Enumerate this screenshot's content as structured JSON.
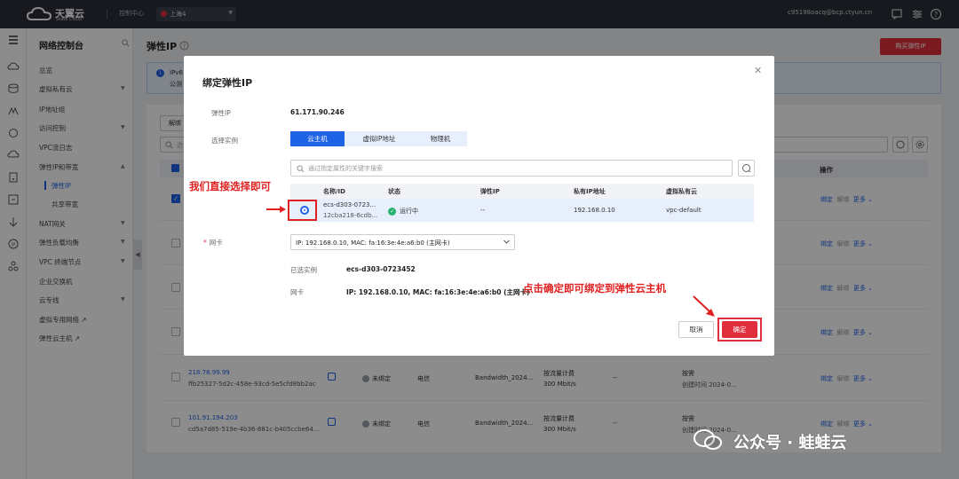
{
  "topbar": {
    "brand": "天翼云",
    "brand_sub": "State Cloud",
    "console": "控制中心",
    "region": "上海4",
    "user": "c95198oacq@bcp.ctyun.cn"
  },
  "sidebar": {
    "title": "网络控制台",
    "items": [
      {
        "label": "总览",
        "caret": false
      },
      {
        "label": "虚拟私有云",
        "caret": true
      },
      {
        "label": "IP地址组",
        "caret": false
      },
      {
        "label": "访问控制",
        "caret": true
      },
      {
        "label": "VPC流日志",
        "caret": false
      },
      {
        "label": "弹性IP和带宽",
        "caret": true
      },
      {
        "label": "弹性IP",
        "caret": false
      },
      {
        "label": "共享带宽",
        "caret": false
      },
      {
        "label": "NAT网关",
        "caret": true
      },
      {
        "label": "弹性负载均衡",
        "caret": true
      },
      {
        "label": "VPC 终端节点",
        "caret": true
      },
      {
        "label": "企业交换机",
        "caret": false
      },
      {
        "label": "云专线",
        "caret": true
      },
      {
        "label": "虚拟专用网络 ↗",
        "caret": false
      },
      {
        "label": "弹性云主机 ↗",
        "caret": false
      }
    ]
  },
  "main": {
    "title": "弹性IP",
    "buy_button": "购买弹性IP",
    "notice_line1": "IPv6",
    "notice_line2": "公测",
    "unbind_button": "解绑",
    "filter_placeholder": "选",
    "ops_header": "操作",
    "row_ops": {
      "bind": "绑定",
      "unbind": "解绑",
      "more": "更多"
    },
    "rows": [
      {
        "ip": "218.78.99.99",
        "id": "ffb25327-5d2c-458e-93cd-5e5cfd8bb2ac",
        "status": "未绑定",
        "isp": "电信",
        "bandwidth": "Bandwidth_2024...",
        "billing1": "按流量计费",
        "billing2": "300 Mbit/s",
        "dash": "--",
        "pay": "按需",
        "created": "创建时间 2024-0..."
      },
      {
        "ip": "101.91.194.203",
        "id": "cd5a7d85-519e-4b36-881c-b405ccbe64...",
        "status": "未绑定",
        "isp": "电信",
        "bandwidth": "Bandwidth_2024...",
        "billing1": "按流量计费",
        "billing2": "300 Mbit/s",
        "dash": "--",
        "pay": "按需",
        "created": "创建时间 2024-0..."
      }
    ]
  },
  "modal": {
    "title": "绑定弹性IP",
    "eip_label": "弹性IP",
    "eip_value": "61.171.90.246",
    "instance_label": "选择实例",
    "tabs": [
      "云主机",
      "虚拟IP地址",
      "物理机"
    ],
    "search_placeholder": "通过指定属性的关键字搜索",
    "columns": [
      "名称/ID",
      "状态",
      "弹性IP",
      "私有IP地址",
      "虚拟私有云"
    ],
    "row": {
      "name": "ecs-d303-0723...",
      "id": "12cba218-6cdb...",
      "status": "运行中",
      "eip": "--",
      "private_ip": "192.168.0.10",
      "vpc": "vpc-default"
    },
    "nic_label": "网卡",
    "nic_value": "IP: 192.168.0.10, MAC: fa:16:3e:4e:a6:b0 (主网卡)",
    "selected_label": "已选实例",
    "selected_value": "ecs-d303-0723452",
    "nic_summary_label": "网卡",
    "nic_summary_value": "IP: 192.168.0.10, MAC: fa:16:3e:4e:a6:b0 (主网卡)",
    "cancel": "取消",
    "ok": "确定"
  },
  "annotations": {
    "select_hint": "我们直接选择即可",
    "confirm_hint": "点击确定即可绑定到弹性云主机"
  },
  "watermark": {
    "text": "公众号 · 蛙蛙云"
  },
  "colors": {
    "accent": "#1e62e6",
    "brand_red": "#e02e3c",
    "topbar": "#2b2f3a",
    "running": "#28b26f"
  }
}
